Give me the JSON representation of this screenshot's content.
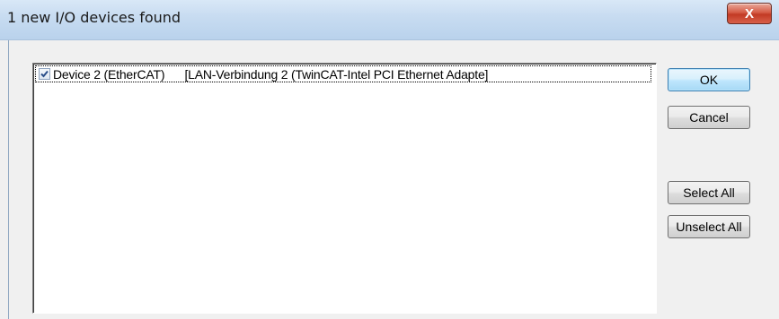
{
  "window": {
    "title": "1 new I/O devices found",
    "close_glyph": "X"
  },
  "devices": {
    "items": [
      {
        "checked": true,
        "name": "Device 2 (EtherCAT)",
        "adapter": "[LAN-Verbindung 2 (TwinCAT-Intel PCI Ethernet Adapte]"
      }
    ]
  },
  "buttons": {
    "ok": "OK",
    "cancel": "Cancel",
    "select_all": "Select All",
    "unselect_all": "Unselect All"
  },
  "colors": {
    "titlebar": "#c8dcf1",
    "close_button": "#c23a24",
    "dialog_background": "#f0f0f0",
    "default_button_border": "#3c7fb1"
  },
  "icons": {
    "close": "close-icon",
    "checkbox": "checkmark-icon"
  }
}
